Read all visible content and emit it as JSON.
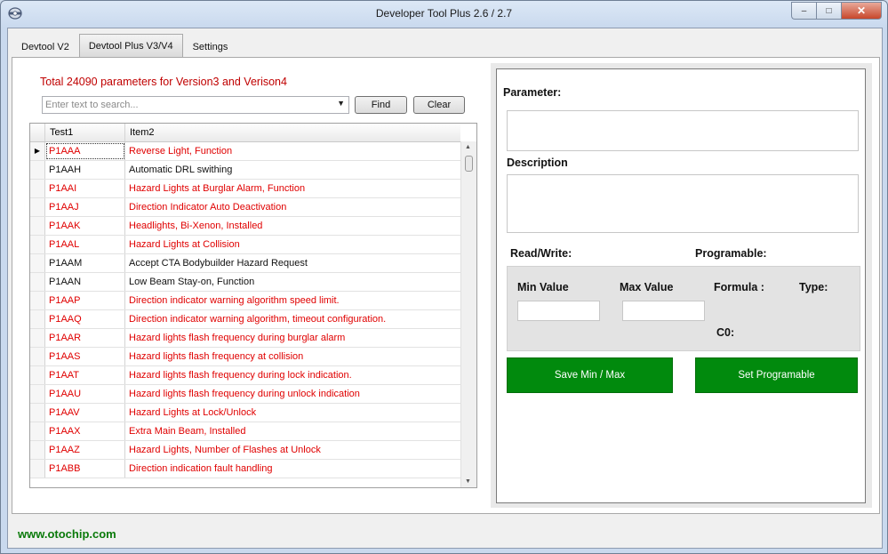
{
  "window": {
    "title": "Developer Tool Plus 2.6 / 2.7",
    "minimize": "–",
    "maximize": "□",
    "close": "✕"
  },
  "tabs": [
    {
      "label": "Devtool V2"
    },
    {
      "label": "Devtool Plus V3/V4"
    },
    {
      "label": "Settings"
    }
  ],
  "left": {
    "total_label": "Total 24090 parameters for Version3 and Verison4",
    "search": {
      "placeholder": "Enter text to search...",
      "value": ""
    },
    "find_label": "Find",
    "clear_label": "Clear",
    "columns": [
      "Test1",
      "Item2"
    ],
    "rows": [
      {
        "code": "P1AAA",
        "item": "Reverse Light, Function",
        "color": "red",
        "current": true
      },
      {
        "code": "P1AAH",
        "item": "Automatic DRL swithing",
        "color": "black"
      },
      {
        "code": "P1AAI",
        "item": "Hazard Lights at Burglar Alarm, Function",
        "color": "red"
      },
      {
        "code": "P1AAJ",
        "item": "Direction Indicator Auto Deactivation",
        "color": "red"
      },
      {
        "code": "P1AAK",
        "item": "Headlights, Bi-Xenon, Installed",
        "color": "red"
      },
      {
        "code": "P1AAL",
        "item": "Hazard Lights at Collision",
        "color": "red"
      },
      {
        "code": "P1AAM",
        "item": "Accept CTA Bodybuilder Hazard Request",
        "color": "black"
      },
      {
        "code": "P1AAN",
        "item": "Low Beam Stay-on, Function",
        "color": "black"
      },
      {
        "code": "P1AAP",
        "item": "Direction indicator warning algorithm speed limit.",
        "color": "red"
      },
      {
        "code": "P1AAQ",
        "item": "Direction indicator warning algorithm, timeout configuration.",
        "color": "red"
      },
      {
        "code": "P1AAR",
        "item": "Hazard lights flash frequency during burglar alarm",
        "color": "red"
      },
      {
        "code": "P1AAS",
        "item": "Hazard lights flash frequency at collision",
        "color": "red"
      },
      {
        "code": "P1AAT",
        "item": "Hazard lights flash frequency during lock indication.",
        "color": "red"
      },
      {
        "code": "P1AAU",
        "item": "Hazard lights flash frequency during unlock indication",
        "color": "red"
      },
      {
        "code": "P1AAV",
        "item": "Hazard Lights at Lock/Unlock",
        "color": "red"
      },
      {
        "code": "P1AAX",
        "item": "Extra Main Beam, Installed",
        "color": "red"
      },
      {
        "code": "P1AAZ",
        "item": "Hazard Lights, Number of Flashes at Unlock",
        "color": "red"
      },
      {
        "code": "P1ABB",
        "item": "Direction indication fault handling",
        "color": "red"
      }
    ]
  },
  "right": {
    "parameter_label": "Parameter:",
    "description_label": "Description",
    "readwrite_label": "Read/Write:",
    "programable_label": "Programable:",
    "min_label": "Min Value",
    "max_label": "Max Value",
    "formula_label": "Formula :",
    "type_label": "Type:",
    "c0_label": "C0:",
    "save_label": "Save Min / Max",
    "setprog_label": "Set Programable"
  },
  "footer": {
    "link": "www.otochip.com"
  },
  "colors": {
    "accent_red": "#e00000",
    "button_green": "#018a0d",
    "footer_green": "#0a7a0a"
  }
}
